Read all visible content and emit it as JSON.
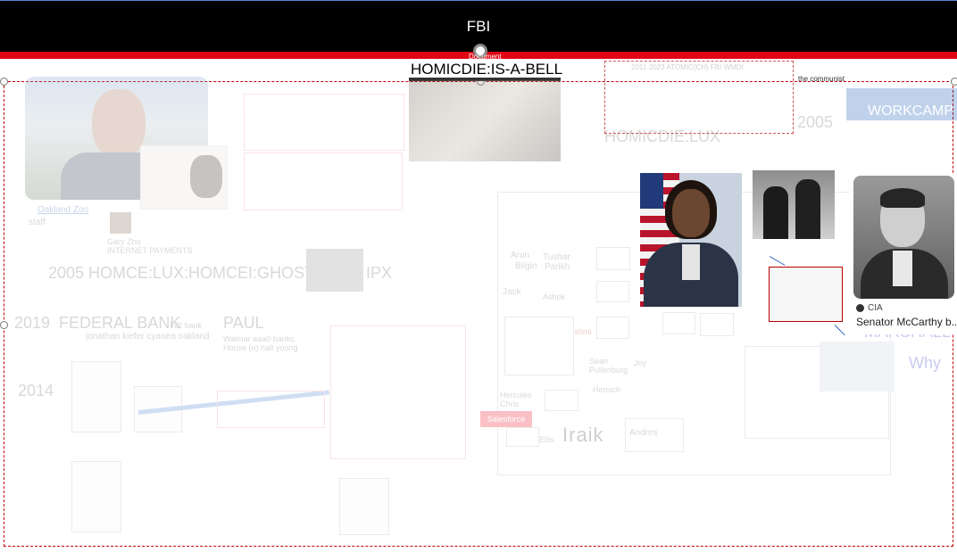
{
  "header": {
    "title": "FBI"
  },
  "selection": {
    "handle_label": "Document",
    "title": "HOMICDIE:IS-A-BELL"
  },
  "board": {
    "caption_oakland_zoo": "Oakland Zoo",
    "caption_staff": "staff",
    "person_gary_name": "Gary Zhu",
    "person_gary_role": "INTERNET PAYMENTS",
    "row_2005_label": "2005 HOMCE:LUX:HOMCEI:GHOST",
    "row_2005_ipx": "IPX",
    "row_2019_year": "2019",
    "row_2019_label": "FEDERAL BANK",
    "row_2019_note": "FBI bank",
    "row_2019_names": "jonathan kiefer  cyanea oakland",
    "row_2019_paul": "PAUL",
    "row_2019_paul_note": "Walmar aaa0 bankc",
    "row_2019_paul_note2": "House (n) halt young",
    "row_2014_year": "2014",
    "homicdie_lux": "HOMICDIE:LUX",
    "year_2005_right": "2005",
    "workcamp": "WORKCAMP",
    "marshall": "MARSHALL",
    "why": "Why",
    "the_communist": "the communist",
    "top_dashed_line": "2011-2023 ATOMIC(CH) FBI WMDI",
    "names": [
      "Arun",
      "Bilgin",
      "Tushar",
      "Parikh",
      "Jack",
      "Ashok",
      "Lakshmi",
      "Sean",
      "Pullenburg",
      "Joy",
      "Hercules",
      "Chris",
      "Hernich",
      "Ellis"
    ],
    "andres": "Andres",
    "fraik": "Iraik",
    "salesforce": "Salesforce"
  },
  "cards": {
    "mccarthy_source": "CIA",
    "mccarthy_title": "Senator McCarthy b..."
  },
  "colors": {
    "header_bg": "#000000",
    "accent_red": "#e10613",
    "header_text": "#ffffff"
  }
}
